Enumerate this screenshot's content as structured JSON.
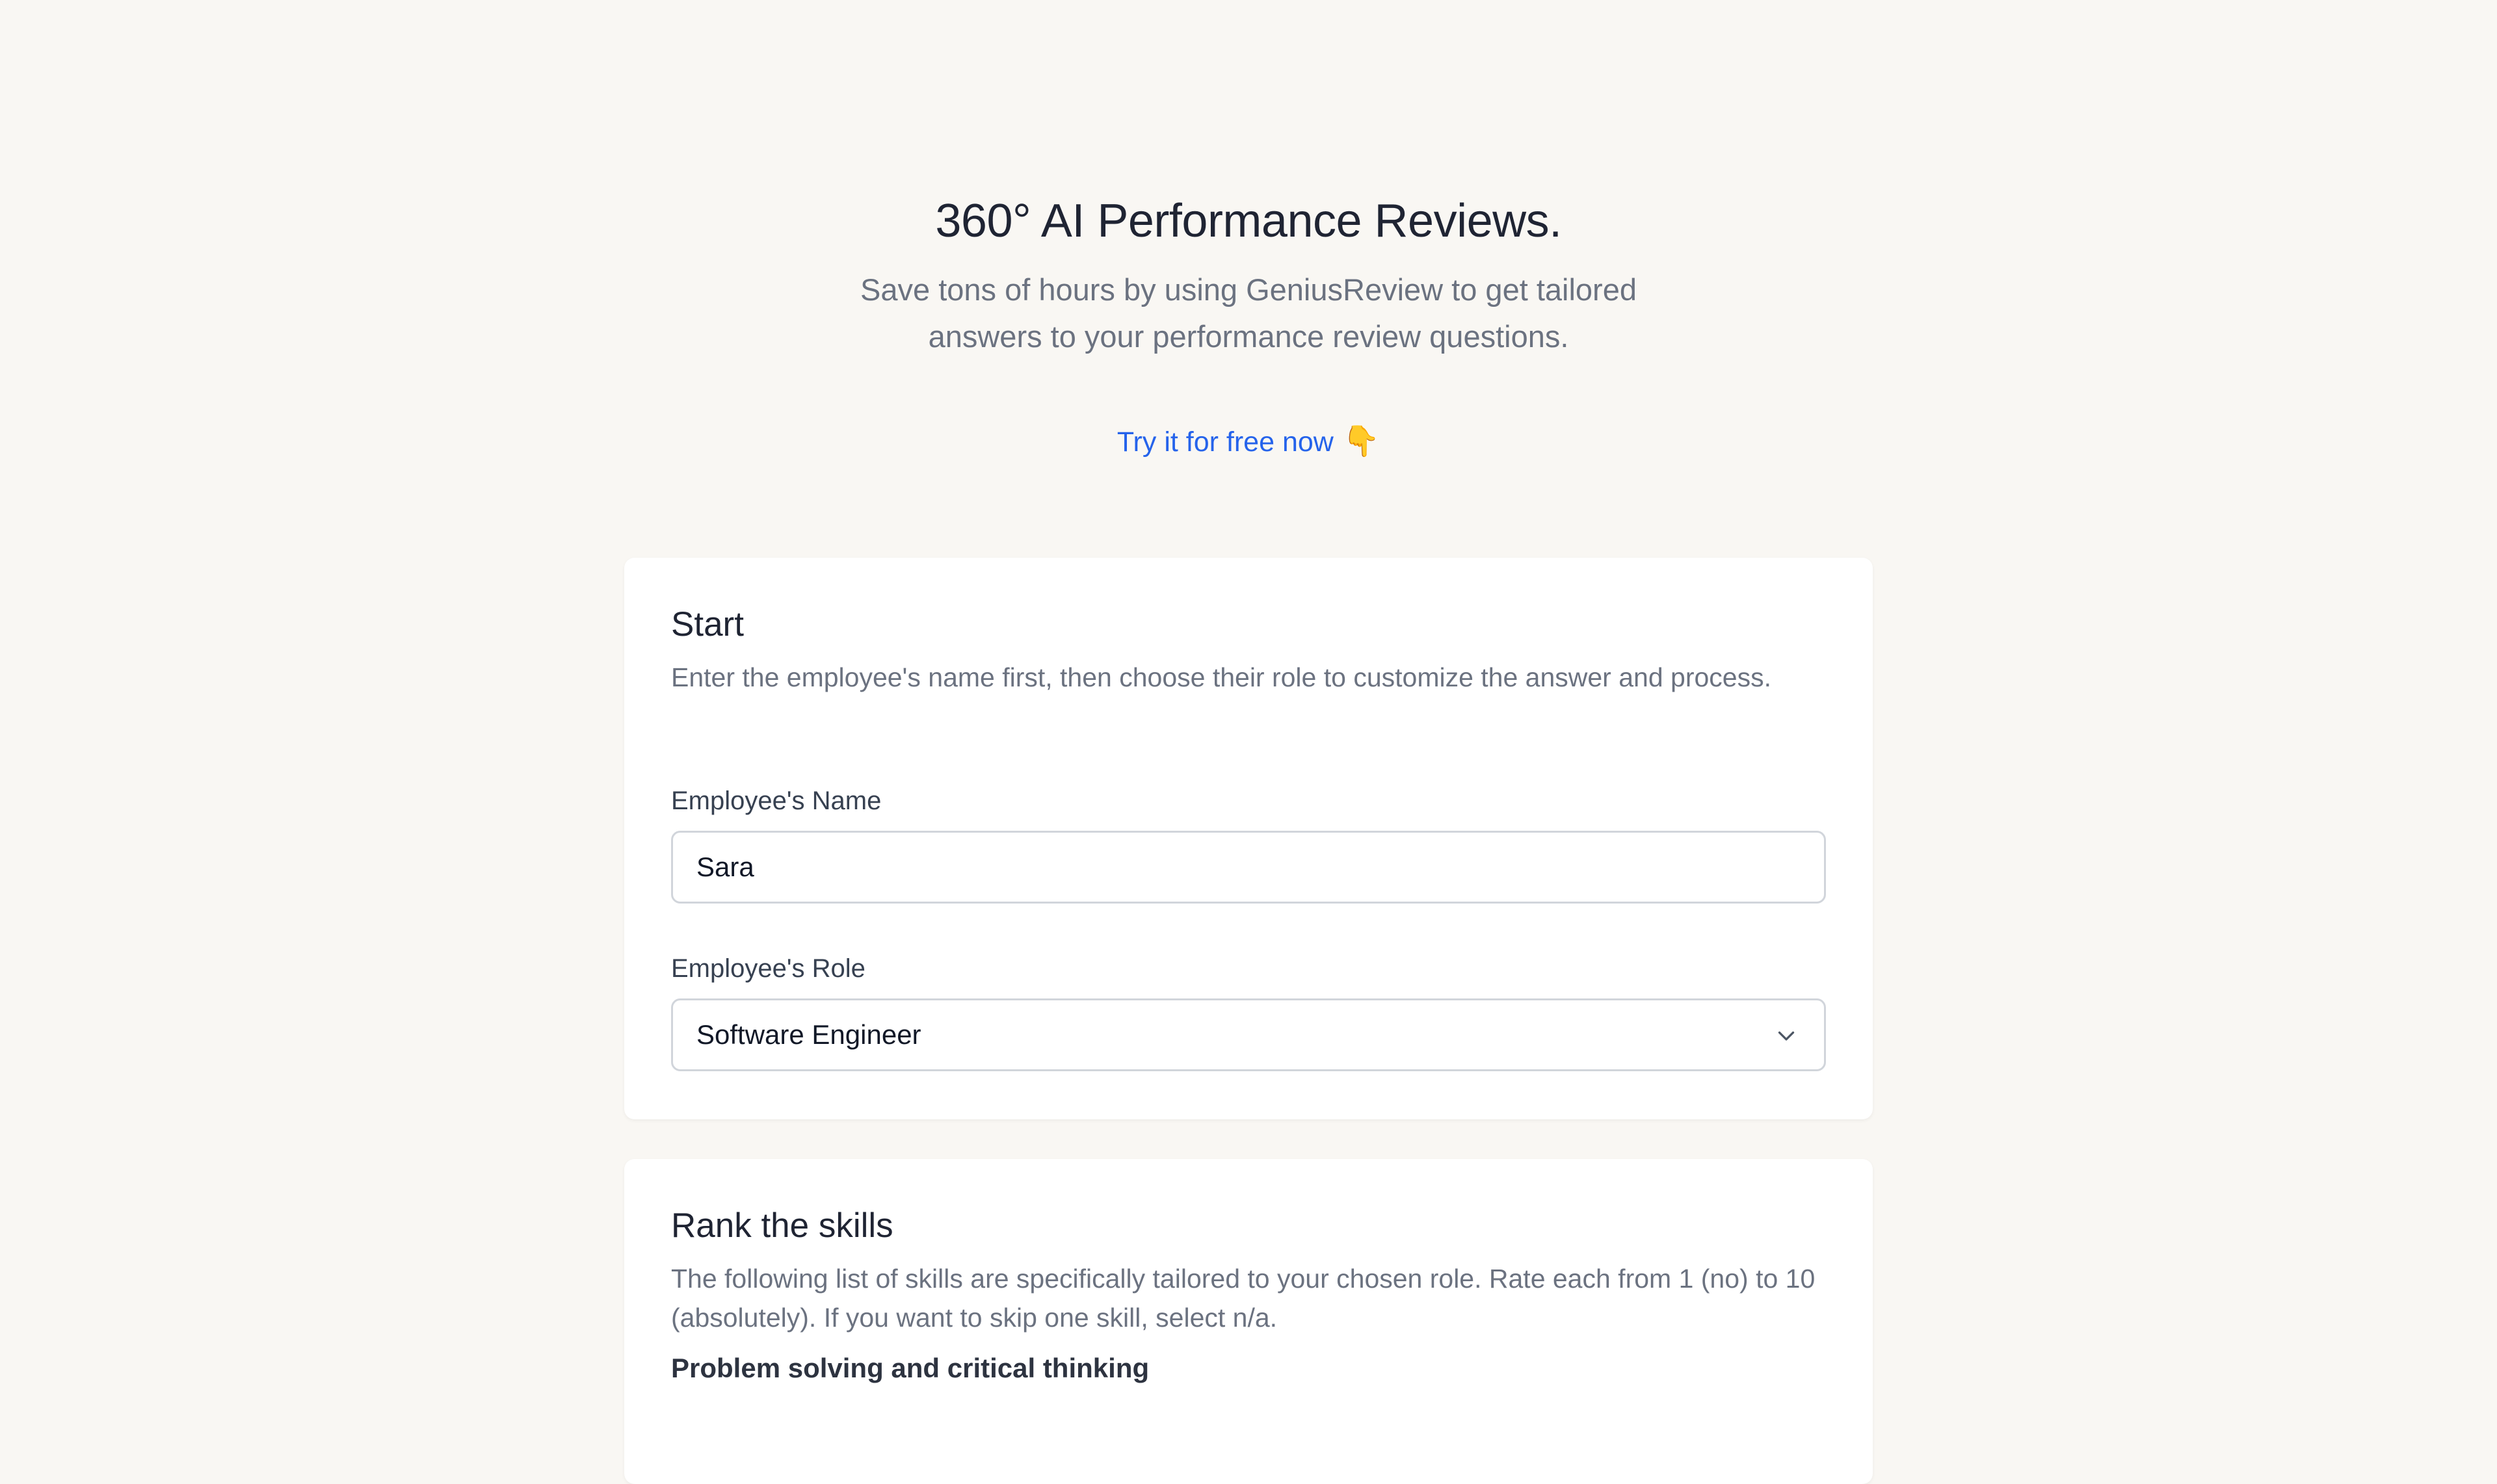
{
  "hero": {
    "title": "360° AI Performance Reviews.",
    "subtitle": "Save tons of hours by using GeniusReview to get tailored answers to your performance review questions.",
    "cta_label": "Try it for free now",
    "cta_emoji": "👇"
  },
  "start_card": {
    "title": "Start",
    "description": "Enter the employee's name first, then choose their role to customize the answer and process.",
    "name_field": {
      "label": "Employee's Name",
      "value": "Sara"
    },
    "role_field": {
      "label": "Employee's Role",
      "selected": "Software Engineer",
      "icon": "chevron-down-icon"
    }
  },
  "skills_card": {
    "title": "Rank the skills",
    "description": "The following list of skills are specifically tailored to your chosen role. Rate each from 1 (no) to 10 (absolutely). If you want to skip one skill, select n/a.",
    "first_skill": "Problem solving and critical thinking"
  },
  "colors": {
    "background": "#f9f7f3",
    "card": "#ffffff",
    "link": "#2563eb",
    "muted_text": "#6b7280",
    "heading": "#1f2433",
    "border": "#d1d5db"
  }
}
